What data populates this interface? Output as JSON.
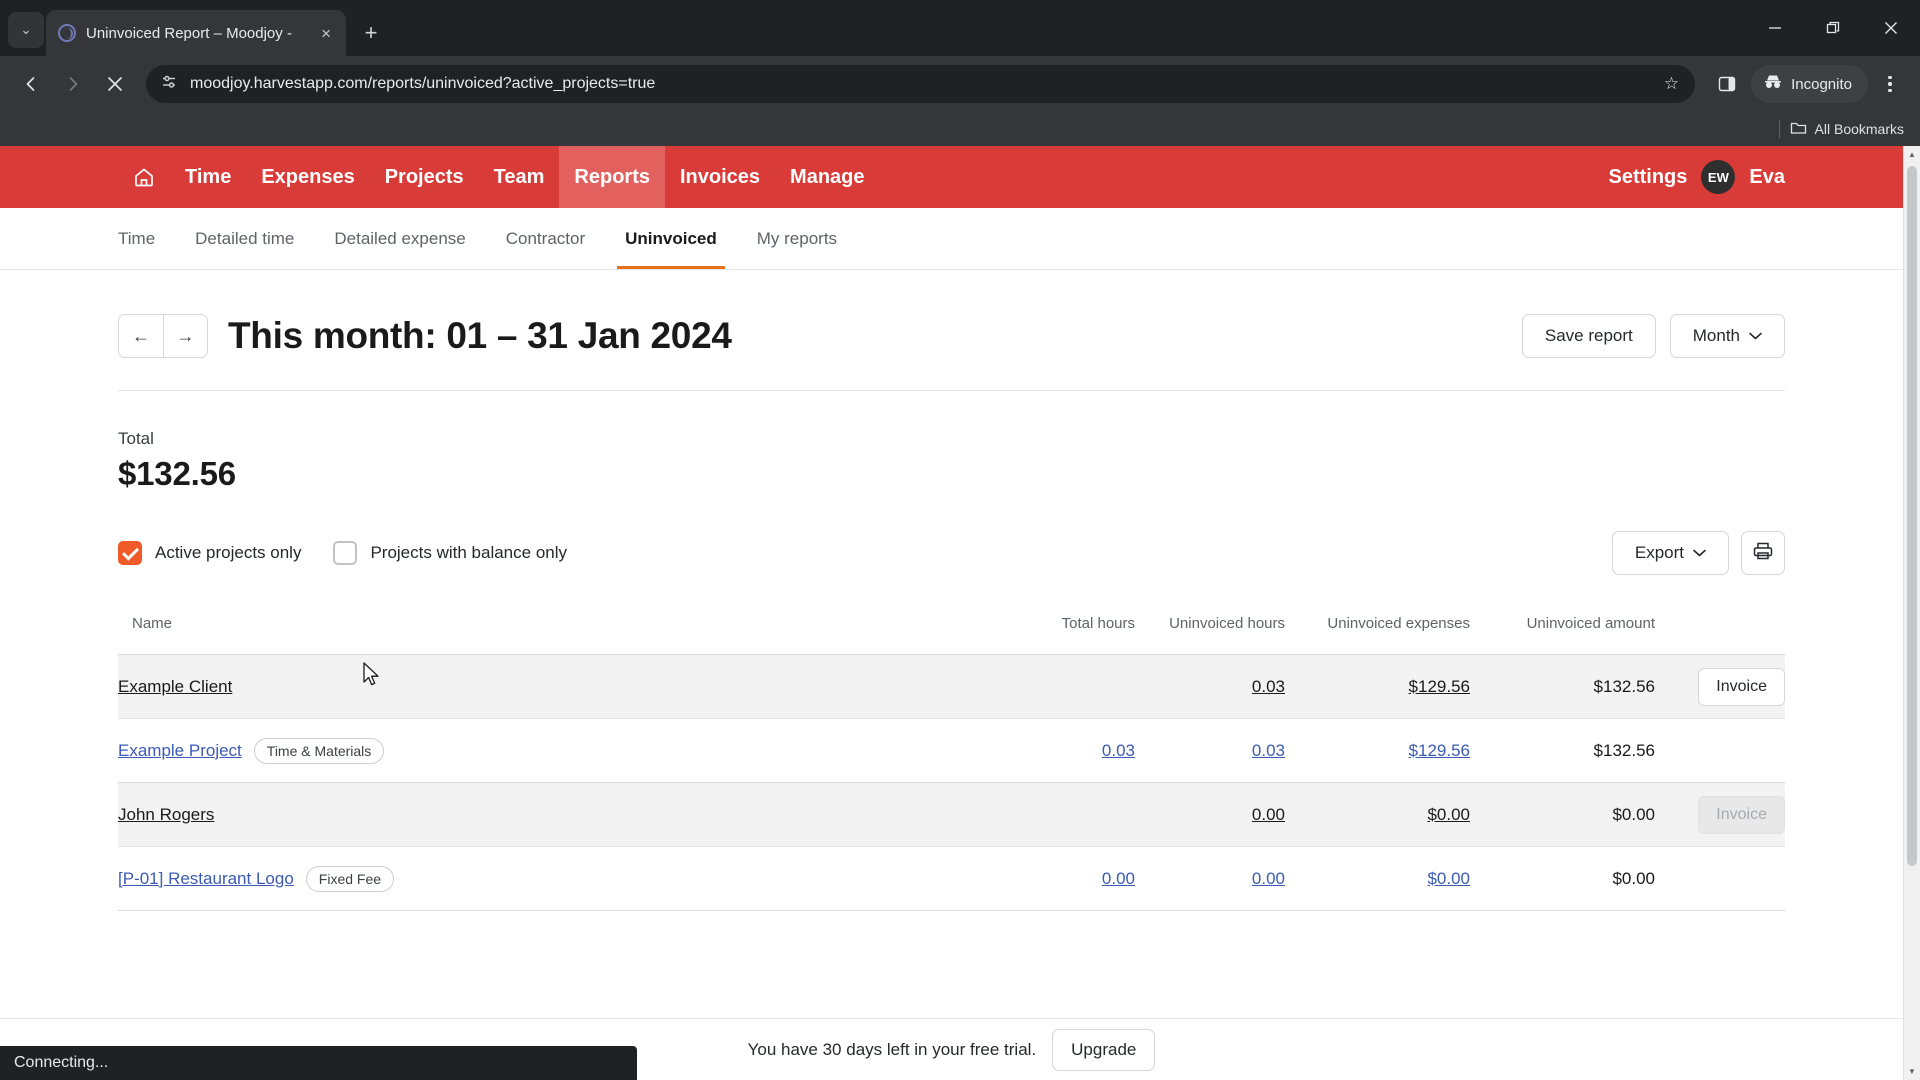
{
  "browser": {
    "tab": {
      "title": "Uninvoiced Report – Moodjoy -",
      "favicon": "moodjoy-favicon",
      "close_label": "×"
    },
    "tab_list_label": "⌄",
    "new_tab_label": "+",
    "url": "moodjoy.harvestapp.com/reports/uninvoiced?active_projects=true",
    "incognito_label": "Incognito",
    "bookmarks_label": "All Bookmarks",
    "window": {
      "minimize": "minimize-icon",
      "maximize": "restore-icon",
      "close": "close-icon"
    },
    "status_text": "Connecting..."
  },
  "app": {
    "nav": {
      "home": "home-icon",
      "items": [
        {
          "label": "Time",
          "active": false
        },
        {
          "label": "Expenses",
          "active": false
        },
        {
          "label": "Projects",
          "active": false
        },
        {
          "label": "Team",
          "active": false
        },
        {
          "label": "Reports",
          "active": true
        },
        {
          "label": "Invoices",
          "active": false
        },
        {
          "label": "Manage",
          "active": false
        }
      ],
      "settings_label": "Settings",
      "avatar_initials": "EW",
      "user_name": "Eva",
      "brand_color": "#d93b38",
      "active_color": "#e2605d"
    },
    "subtabs": [
      {
        "label": "Time",
        "active": false
      },
      {
        "label": "Detailed time",
        "active": false
      },
      {
        "label": "Detailed expense",
        "active": false
      },
      {
        "label": "Contractor",
        "active": false
      },
      {
        "label": "Uninvoiced",
        "active": true
      },
      {
        "label": "My reports",
        "active": false
      }
    ],
    "header": {
      "prev_label": "←",
      "next_label": "→",
      "title": "This month: 01 – 31 Jan 2024",
      "save_report_label": "Save report",
      "period_label": "Month",
      "period_caret": "⌄"
    },
    "total": {
      "label": "Total",
      "value": "$132.56"
    },
    "filters": {
      "active_projects": {
        "label": "Active projects only",
        "checked": true
      },
      "balance_only": {
        "label": "Projects with balance only",
        "checked": false
      },
      "accent_color": "#f05a28"
    },
    "actions": {
      "export_label": "Export",
      "export_caret": "⌄",
      "print_icon": "printer-icon"
    },
    "table": {
      "columns": [
        "Name",
        "Total hours",
        "Uninvoiced hours",
        "Uninvoiced expenses",
        "Uninvoiced amount",
        ""
      ],
      "rows": [
        {
          "type": "client",
          "name": "Example Client",
          "badge": null,
          "total_hours": "",
          "uninvoiced_hours": "0.03",
          "uninvoiced_expenses": "$129.56",
          "uninvoiced_amount": "$132.56",
          "action": "Invoice",
          "action_disabled": false
        },
        {
          "type": "project",
          "name": "Example Project",
          "badge": "Time & Materials",
          "total_hours": "0.03",
          "uninvoiced_hours": "0.03",
          "uninvoiced_expenses": "$129.56",
          "uninvoiced_amount": "$132.56",
          "action": "",
          "action_disabled": false
        },
        {
          "type": "client",
          "name": "John Rogers",
          "badge": null,
          "total_hours": "",
          "uninvoiced_hours": "0.00",
          "uninvoiced_expenses": "$0.00",
          "uninvoiced_amount": "$0.00",
          "action": "Invoice",
          "action_disabled": true
        },
        {
          "type": "project",
          "name": "[P-01] Restaurant Logo",
          "badge": "Fixed Fee",
          "total_hours": "0.00",
          "uninvoiced_hours": "0.00",
          "uninvoiced_expenses": "$0.00",
          "uninvoiced_amount": "$0.00",
          "action": "",
          "action_disabled": false
        }
      ]
    },
    "trial": {
      "text": "You have 30 days left in your free trial.",
      "upgrade_label": "Upgrade"
    }
  }
}
